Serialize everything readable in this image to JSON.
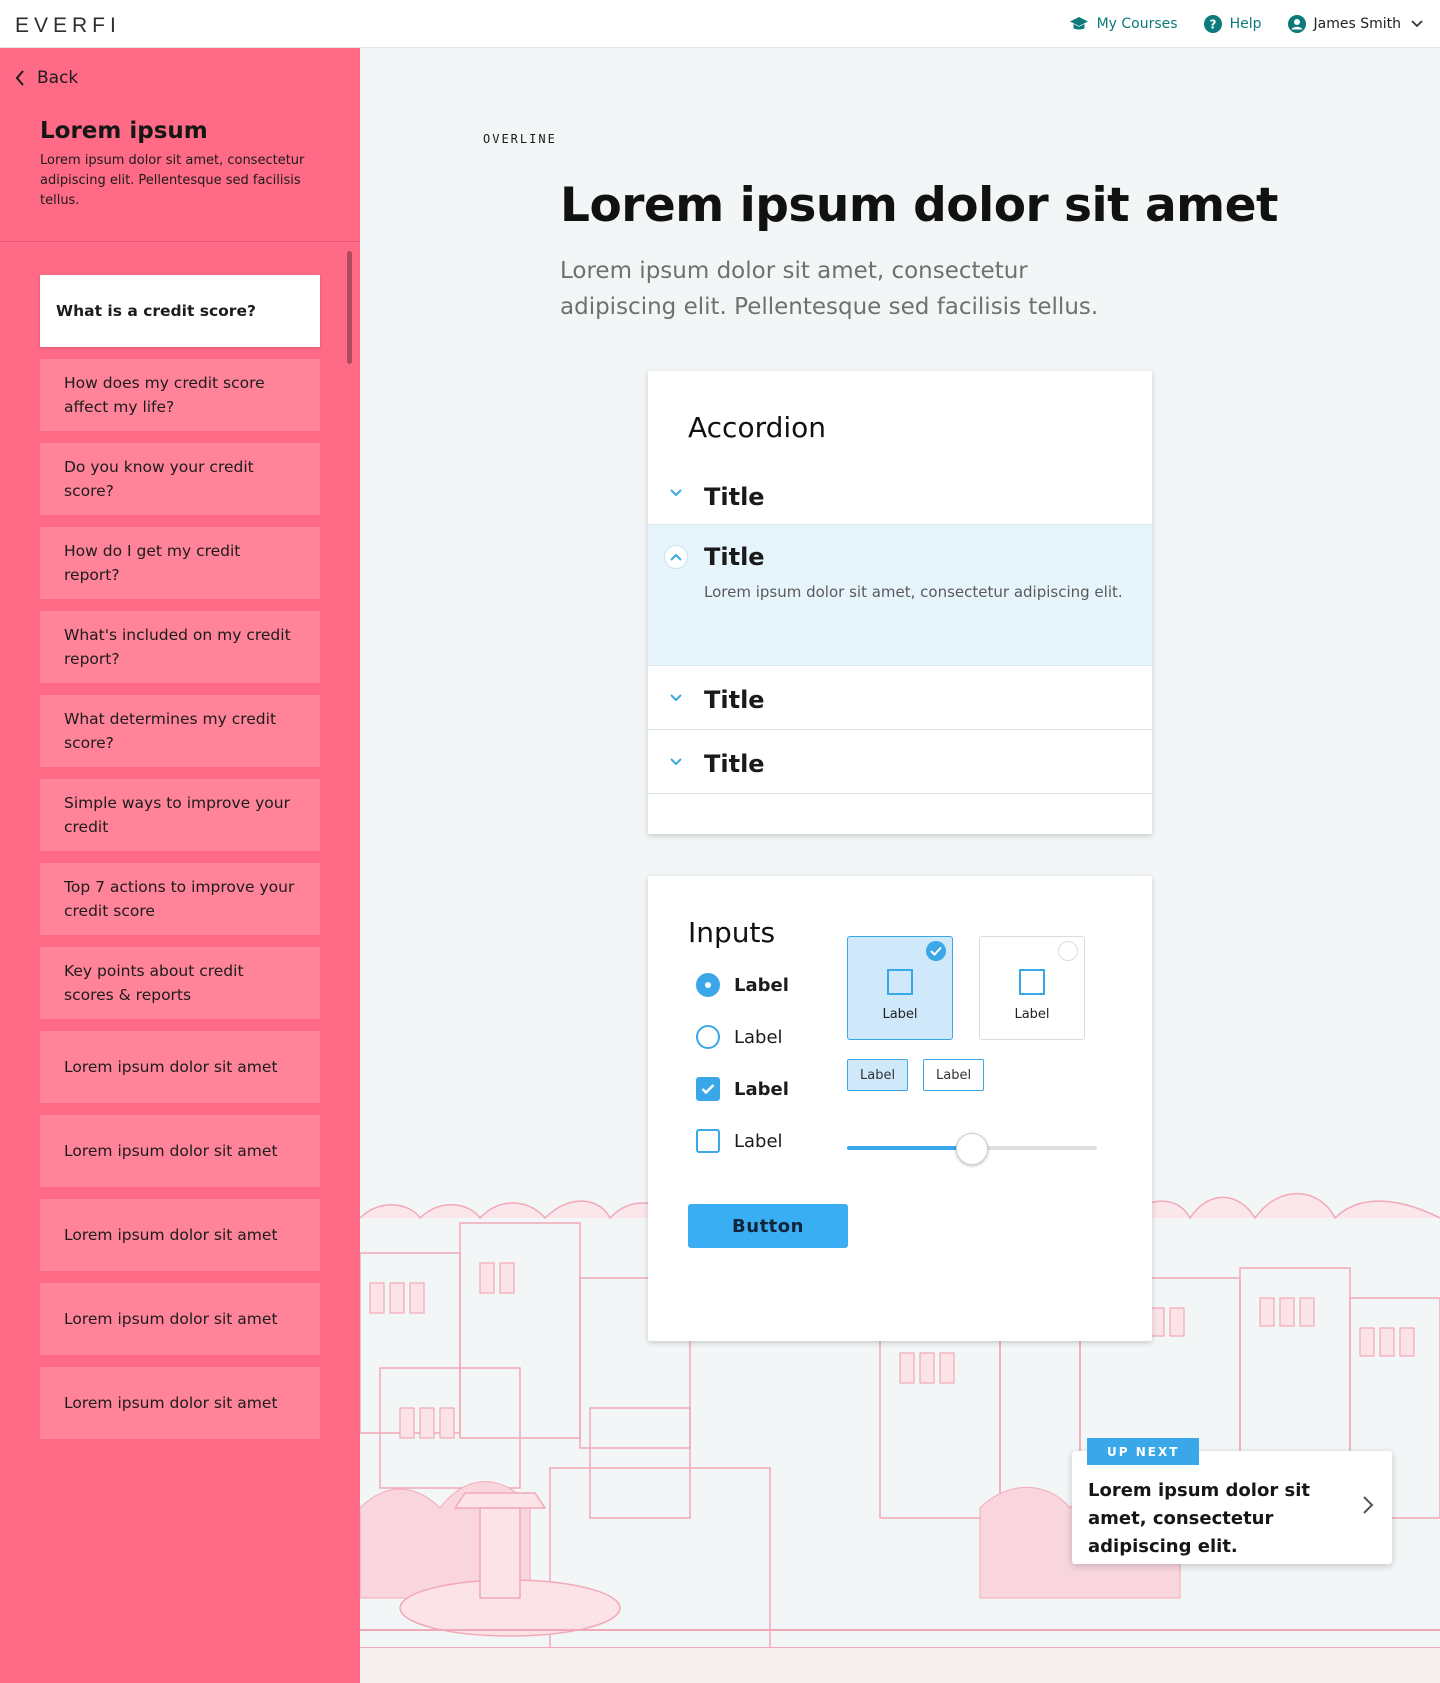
{
  "header": {
    "logo": "EVERFI",
    "my_courses": "My Courses",
    "help": "Help",
    "user_name": "James Smith"
  },
  "sidebar": {
    "back_label": "Back",
    "title": "Lorem ipsum",
    "description": "Lorem ipsum dolor sit amet, consectetur adipiscing elit. Pellentesque sed facilisis tellus.",
    "lessons": [
      "What is a credit score?",
      "How does my credit score affect my life?",
      "Do you know your credit score?",
      "How do I get my credit report?",
      "What's included on my credit report?",
      "What determines my credit score?",
      "Simple ways to improve your credit",
      "Top 7 actions to improve your credit score",
      "Key points about credit scores & reports",
      "Lorem ipsum dolor sit amet",
      "Lorem ipsum dolor sit amet",
      "Lorem ipsum dolor sit amet",
      "Lorem ipsum dolor sit amet",
      "Lorem ipsum dolor sit amet"
    ]
  },
  "main": {
    "overline": "OVERLINE",
    "title": "Lorem ipsum dolor sit amet",
    "subtitle": "Lorem ipsum dolor sit amet, consectetur adipiscing elit. Pellentesque sed facilisis tellus."
  },
  "accordion": {
    "heading": "Accordion",
    "items": [
      {
        "title": "Title",
        "open": false
      },
      {
        "title": "Title",
        "open": true,
        "body": "Lorem ipsum dolor sit amet, consectetur adipiscing elit."
      },
      {
        "title": "Title",
        "open": false
      },
      {
        "title": "Title",
        "open": false
      }
    ]
  },
  "inputs": {
    "heading": "Inputs",
    "radio_1": "Label",
    "radio_2": "Label",
    "checkbox_1": "Label",
    "checkbox_2": "Label",
    "tile_1": "Label",
    "tile_2": "Label",
    "chip_1": "Label",
    "chip_2": "Label",
    "slider_value": 0.5,
    "button_label": "Button"
  },
  "up_next": {
    "badge": "UP NEXT",
    "text": "Lorem ipsum dolor sit amet, consectetur adipiscing elit."
  },
  "colors": {
    "sidebar": "#ff6b87",
    "accent": "#3aa7e8",
    "link": "#0c7a7a"
  }
}
